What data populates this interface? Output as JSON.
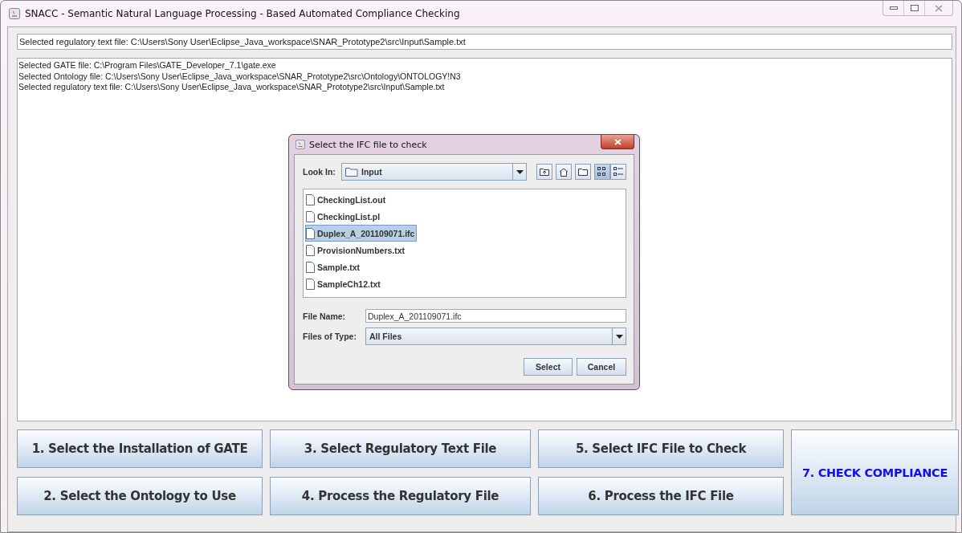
{
  "window": {
    "title": "SNACC - Semantic Natural Language Processing - Based Automated Compliance Checking"
  },
  "path_field": {
    "value": "Selected regulatory text file: C:\\Users\\Sony User\\Eclipse_Java_workspace\\SNAR_Prototype2\\src\\Input\\Sample.txt"
  },
  "log": [
    "Selected GATE file: C:\\Program Files\\GATE_Developer_7.1\\gate.exe",
    "Selected Ontology file: C:\\Users\\Sony User\\Eclipse_Java_workspace\\SNAR_Prototype2\\src\\Ontology\\ONTOLOGY!N3",
    "Selected regulatory text file: C:\\Users\\Sony User\\Eclipse_Java_workspace\\SNAR_Prototype2\\src\\Input\\Sample.txt"
  ],
  "step_buttons": [
    "1. Select the Installation of GATE",
    "2. Select the Ontology to Use",
    "3. Select Regulatory Text File",
    "4. Process the Regulatory File",
    "5. Select IFC File to Check",
    "6. Process the IFC File"
  ],
  "check_button": {
    "label": "7. CHECK COMPLIANCE"
  },
  "dialog": {
    "title": "Select the IFC file to check",
    "look_in_label": "Look In:",
    "look_in_value": "Input",
    "view_buttons": [
      {
        "kind": "list",
        "selected": true
      },
      {
        "kind": "details",
        "selected": false
      }
    ],
    "files": [
      {
        "name": "CheckingList.out",
        "selected": false
      },
      {
        "name": "CheckingList.pl",
        "selected": false
      },
      {
        "name": "Duplex_A_201109071.ifc",
        "selected": true
      },
      {
        "name": "ProvisionNumbers.txt",
        "selected": false
      },
      {
        "name": "Sample.txt",
        "selected": false
      },
      {
        "name": "SampleCh12.txt",
        "selected": false
      }
    ],
    "file_name_label": "File Name:",
    "file_name_value": "Duplex_A_201109071.ifc",
    "file_type_label": "Files of Type:",
    "file_type_value": "All Files",
    "buttons": [
      "Select",
      "Cancel"
    ]
  }
}
